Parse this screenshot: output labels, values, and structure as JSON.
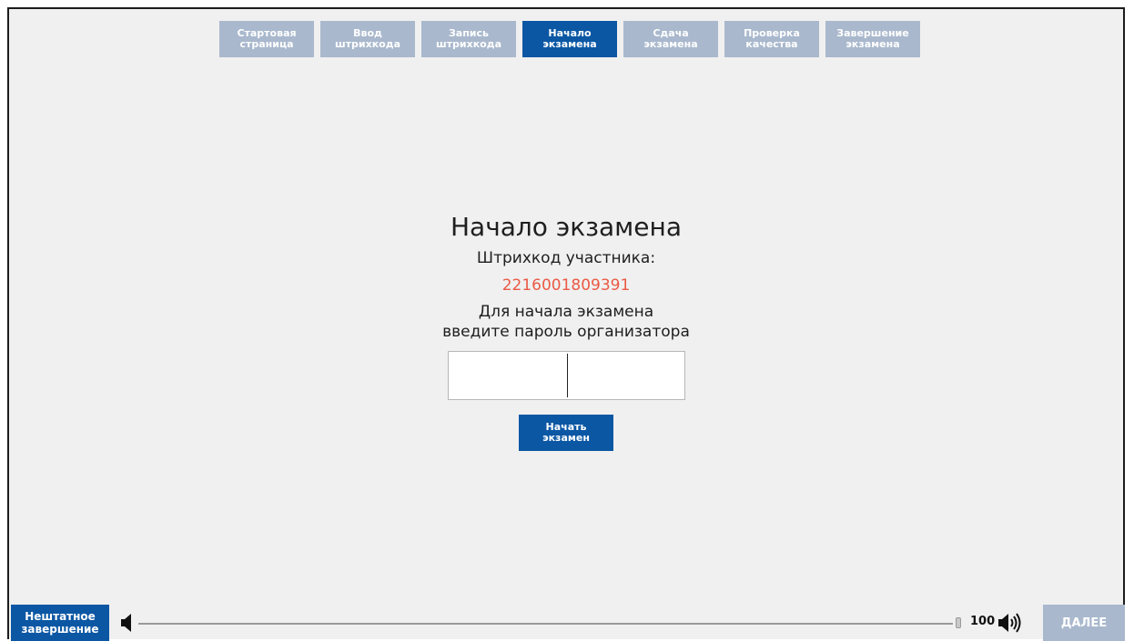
{
  "steps": [
    {
      "line1": "Стартовая",
      "line2": "страница"
    },
    {
      "line1": "Ввод",
      "line2": "штрихкода"
    },
    {
      "line1": "Запись",
      "line2": "штрихкода"
    },
    {
      "line1": "Начало",
      "line2": "экзамена"
    },
    {
      "line1": "Сдача",
      "line2": "экзамена"
    },
    {
      "line1": "Проверка",
      "line2": "качества"
    },
    {
      "line1": "Завершение",
      "line2": "экзамена"
    }
  ],
  "active_step": "Начало экзамена",
  "main": {
    "title": "Начало экзамена",
    "barcode_label": "Штрихкод участника:",
    "barcode_value": "2216001809391",
    "instruction_line1": "Для начала экзамена",
    "instruction_line2": "введите пароль организатора",
    "password_value": "",
    "start_button_line1": "Начать",
    "start_button_line2": "экзамен"
  },
  "footer": {
    "abort_line1": "Нештатное",
    "abort_line2": "завершение",
    "volume_value": "100",
    "next_label": "ДАЛЕЕ",
    "volume_low_icon": "speaker-low-icon",
    "volume_high_icon": "speaker-high-icon"
  },
  "colors": {
    "active_step": "#0b57a4",
    "inactive_step": "#a9b8cd",
    "barcode_value": "#ea5a45",
    "background": "#f0f0f0"
  }
}
